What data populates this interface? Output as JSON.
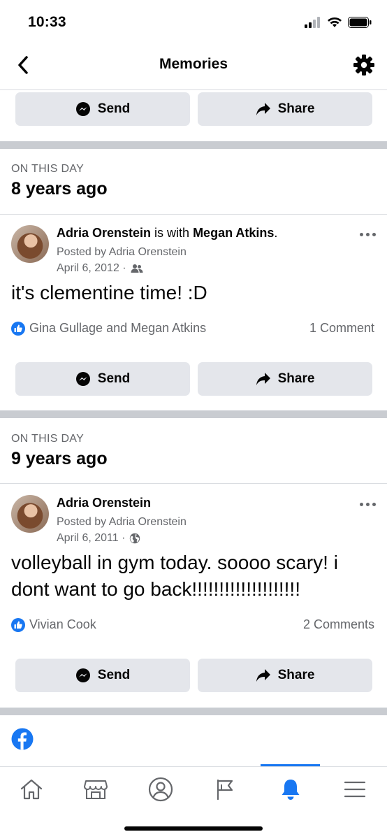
{
  "status": {
    "time": "10:33"
  },
  "header": {
    "title": "Memories"
  },
  "actions": {
    "send_label": "Send",
    "share_label": "Share"
  },
  "memories": [
    {
      "on_this_day": "ON THIS DAY",
      "years_ago": "8 years ago",
      "author": "Adria Orenstein",
      "with_text": " is with ",
      "tagged": "Megan Atkins",
      "period": ".",
      "posted_by": "Posted by Adria Orenstein",
      "date": "April 6, 2012 ·",
      "audience_icon": "friends-icon",
      "text": "it's clementine time! :D",
      "reactions": "Gina Gullage and Megan Atkins",
      "comments": "1 Comment"
    },
    {
      "on_this_day": "ON THIS DAY",
      "years_ago": "9 years ago",
      "author": "Adria Orenstein",
      "posted_by": "Posted by Adria Orenstein",
      "date": "April 6, 2011 ·",
      "audience_icon": "globe-icon",
      "text": "volleyball in gym today. soooo scary! i dont want to go back!!!!!!!!!!!!!!!!!!!!",
      "reactions": "Vivian Cook",
      "comments": "2 Comments"
    }
  ],
  "nav": {
    "items": [
      "home-icon",
      "marketplace-icon",
      "profile-icon",
      "pages-flag-icon",
      "notifications-bell-icon",
      "menu-icon"
    ],
    "active": "notifications-bell-icon"
  },
  "colors": {
    "accent": "#1877f2",
    "button_bg": "#e4e6eb",
    "separator": "#c9ccd1",
    "secondary_text": "#65676b"
  }
}
